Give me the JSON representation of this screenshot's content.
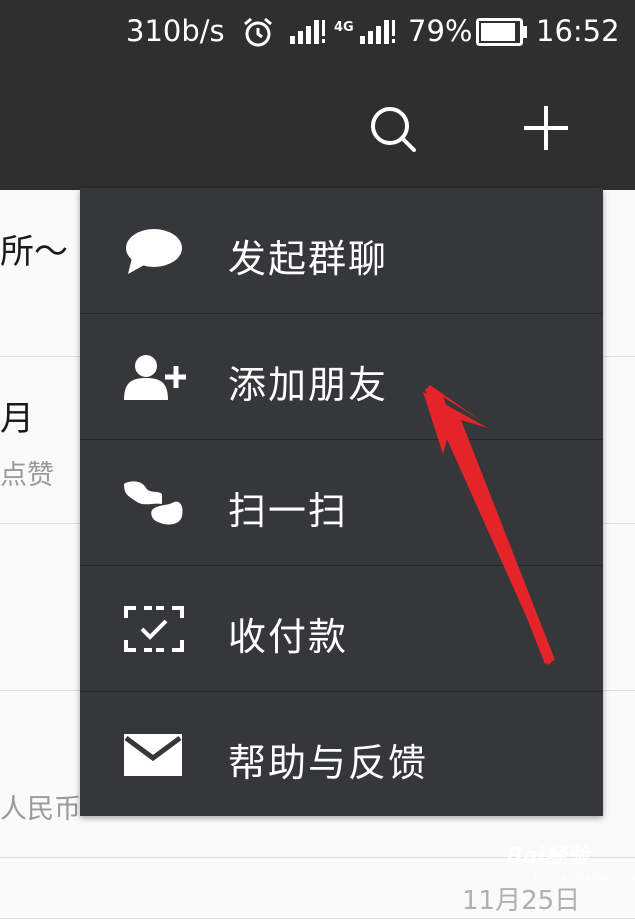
{
  "status_bar": {
    "net_speed": "310b/s",
    "network_type": "4G",
    "battery_percent": "79%",
    "time": "16:52",
    "icons": [
      "alarm-icon",
      "signal-icon",
      "battery-icon"
    ]
  },
  "title_bar": {
    "icons": [
      "search-icon",
      "plus-icon"
    ]
  },
  "chat_list": {
    "rows": [
      {
        "name": "所～",
        "preview": "",
        "date": ""
      },
      {
        "name": "月",
        "preview": "点赞",
        "date": ""
      },
      {
        "name": "",
        "preview": "",
        "date": ""
      },
      {
        "name": "",
        "preview": "",
        "date": ""
      },
      {
        "name": "",
        "preview": "人民币",
        "date": ""
      },
      {
        "name": "",
        "preview": "",
        "date": "11月25日"
      }
    ]
  },
  "menu": {
    "items": [
      {
        "label": "发起群聊",
        "icon": "chat-bubble-icon"
      },
      {
        "label": "添加朋友",
        "icon": "add-friend-icon"
      },
      {
        "label": "扫一扫",
        "icon": "scan-icon"
      },
      {
        "label": "收付款",
        "icon": "payment-icon"
      },
      {
        "label": "帮助与反馈",
        "icon": "mail-icon"
      }
    ]
  },
  "colors": {
    "top_bar": "#2f2f30",
    "menu_bg": "#36373a",
    "annotation_arrow": "#e5242a"
  },
  "watermark": {
    "text": "Bai经验",
    "sub": "jingyan.baidu.com"
  }
}
